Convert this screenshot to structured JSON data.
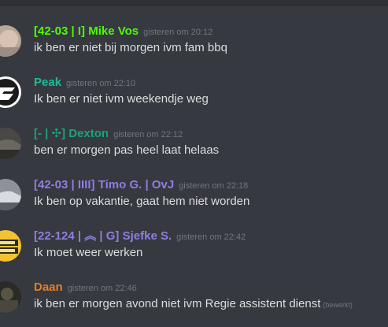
{
  "messages": [
    {
      "username": "[42-03 | I] Mike Vos",
      "name_color": "#4cff00",
      "timestamp": "gisteren om 20:12",
      "text": "ik ben er niet bij morgen ivm fam bbq",
      "avatar_icon": "face-photo-avatar"
    },
    {
      "username": "Peak",
      "name_color": "#1abc9c",
      "timestamp": "gisteren om 22:10",
      "text": "Ik ben er niet ivm weekendje weg",
      "avatar_icon": "logo-avatar"
    },
    {
      "username": "[- | ✣] Dexton",
      "name_color": "#1aa37a",
      "timestamp": "gisteren om 22:12",
      "text": "ben er morgen pas heel laat helaas",
      "avatar_icon": "car-photo-avatar"
    },
    {
      "username": "[42-03 | IIII] Timo G. | OvJ",
      "name_color": "#8f7ee0",
      "timestamp": "gisteren om 22:18",
      "text": "Ik ben op vakantie, gaat hem niet worden",
      "avatar_icon": "car-photo-avatar"
    },
    {
      "username": "[22-124 | ︽ | G] Sjefke S.",
      "name_color": "#8f7ee0",
      "timestamp": "gisteren om 22:42",
      "text": "Ik moet weer werken",
      "avatar_icon": "yellow-logo-avatar"
    },
    {
      "username": "Daan",
      "name_color": "#e67e22",
      "timestamp": "gisteren om 22:46",
      "text": "ik ben er morgen avond niet ivm Regie assistent dienst",
      "edited": "(bewerkt)",
      "avatar_icon": "photo-avatar"
    }
  ]
}
